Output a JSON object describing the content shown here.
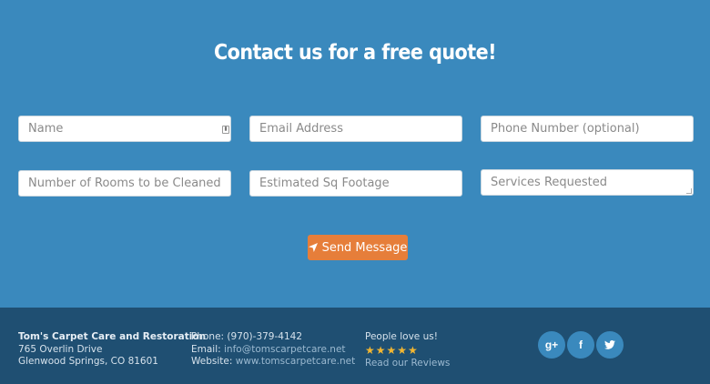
{
  "contact": {
    "title": "Contact us for a free quote!",
    "fields": {
      "name": "Name",
      "email": "Email Address",
      "phone": "Phone Number (optional)",
      "rooms": "Number of Rooms to be Cleaned",
      "sqft": "Estimated Sq Footage",
      "services": "Services Requested"
    },
    "send_label": "Send Message"
  },
  "footer": {
    "company": {
      "name": "Tom's Carpet Care and Restoration",
      "street": "765 Overlin Drive",
      "city": "Glenwood Springs, CO 81601"
    },
    "contact": {
      "phone_label": "Phone:",
      "phone": "(970)-379-4142",
      "email_label": "Email:",
      "email": "info@tomscarpetcare.net",
      "website_label": "Website:",
      "website": "www.tomscarpetcare.net"
    },
    "reviews": {
      "heading": "People love us!",
      "stars": "★★★★★",
      "link": "Read our Reviews"
    },
    "social": {
      "google_glyph": "g+",
      "facebook_glyph": "f"
    }
  },
  "colors": {
    "contact_bg": "#3a89bd",
    "footer_bg": "#1f4f72",
    "accent_button": "#e67e3a",
    "star": "#f2b632"
  }
}
